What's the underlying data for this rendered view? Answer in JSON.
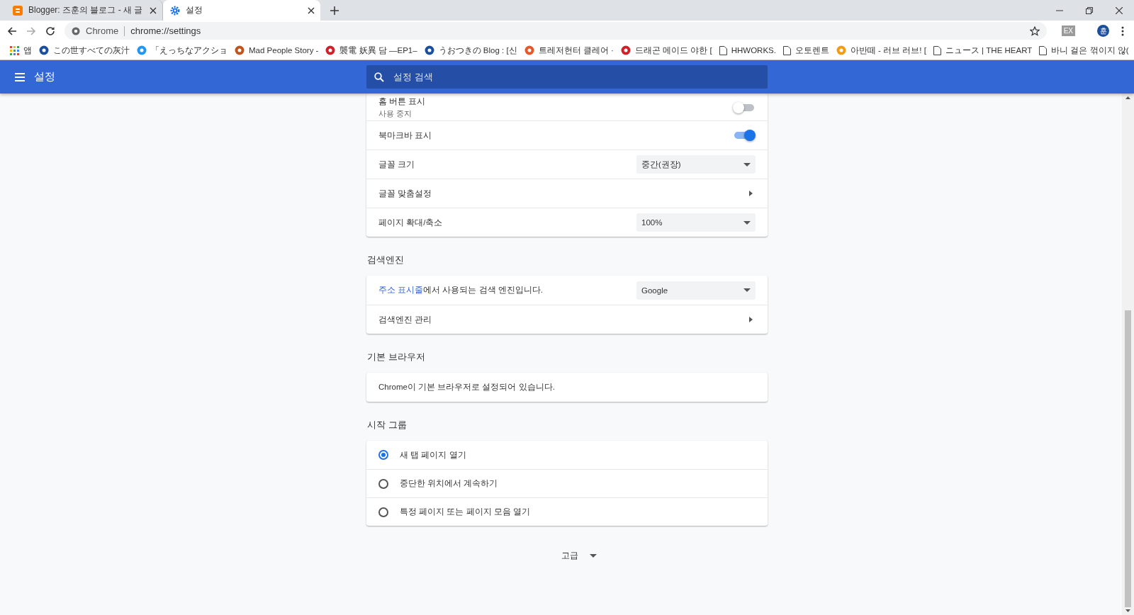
{
  "tabs": [
    {
      "title": "Blogger: 즈훈의 블로그 - 새 글",
      "selected": false
    },
    {
      "title": "설정",
      "selected": true
    }
  ],
  "toolbar": {
    "chip": "Chrome",
    "url": "chrome://settings",
    "extension": "EX",
    "avatar_letter": "훈"
  },
  "bookmarks": [
    {
      "label": "앱",
      "kind": "apps"
    },
    {
      "label": "この世すべての灰汁",
      "kind": "favicon",
      "color": "#1a4fa0"
    },
    {
      "label": "「えっちなアクショ",
      "kind": "favicon",
      "color": "#2196f3"
    },
    {
      "label": "Mad People Story -",
      "kind": "favicon",
      "color": "#c0541c"
    },
    {
      "label": "襲電 妖異 담 —EP1–",
      "kind": "favicon",
      "color": "#d0202a"
    },
    {
      "label": "うおつきの Blog : [신",
      "kind": "favicon",
      "color": "#1a4fa0"
    },
    {
      "label": "트레저헌터 클레어 ·",
      "kind": "favicon",
      "color": "#e8572a"
    },
    {
      "label": "드래곤 메이드 야한 [",
      "kind": "favicon",
      "color": "#d0202a"
    },
    {
      "label": "HHWORKS.",
      "kind": "page"
    },
    {
      "label": "오토렌트",
      "kind": "page"
    },
    {
      "label": "아반떼 - 러브 러브! [",
      "kind": "favicon",
      "color": "#f39c12"
    },
    {
      "label": "ニュース | THE HEART",
      "kind": "page"
    },
    {
      "label": "바니 걸은 꺾이지 않(",
      "kind": "page"
    }
  ],
  "header": {
    "title": "설정",
    "search_placeholder": "설정 검색"
  },
  "sections": [
    {
      "rows": [
        {
          "kind": "toggle",
          "label": "홈 버튼 표시",
          "sublabel": "사용 중지",
          "on": false
        },
        {
          "kind": "toggle",
          "label": "북마크바 표시",
          "on": true
        },
        {
          "kind": "select",
          "label": "글꼴 크기",
          "value": "중간(권장)"
        },
        {
          "kind": "link",
          "label": "글꼴 맞춤설정"
        },
        {
          "kind": "select",
          "label": "페이지 확대/축소",
          "value": "100%"
        }
      ]
    },
    {
      "title": "검색엔진",
      "rows": [
        {
          "kind": "select",
          "link": "주소 표시줄",
          "label": "에서 사용되는 검색 엔진입니다.",
          "value": "Google"
        },
        {
          "kind": "link",
          "label": "검색엔진 관리"
        }
      ]
    },
    {
      "title": "기본 브라우저",
      "rows": [
        {
          "kind": "text",
          "label": "Chrome이 기본 브라우저로 설정되어 있습니다."
        }
      ]
    },
    {
      "title": "시작 그룹",
      "rows": [
        {
          "kind": "radio",
          "label": "새 탭 페이지 열기",
          "selected": true
        },
        {
          "kind": "radio",
          "label": "중단한 위치에서 계속하기",
          "selected": false
        },
        {
          "kind": "radio",
          "label": "특정 페이지 또는 페이지 모음 열기",
          "selected": false
        }
      ]
    }
  ],
  "advanced": {
    "label": "고급"
  }
}
